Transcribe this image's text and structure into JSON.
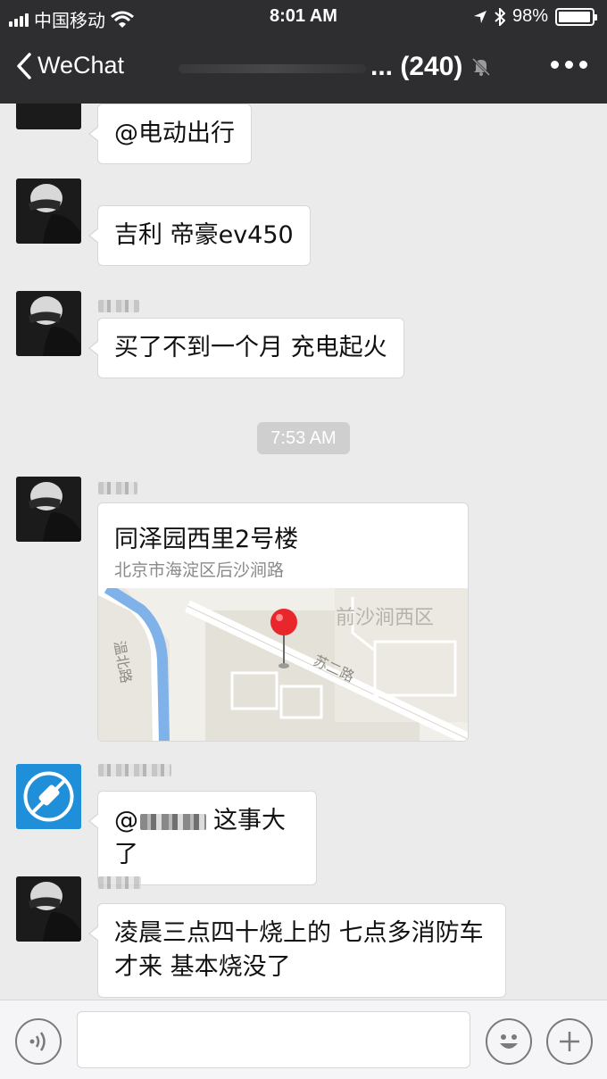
{
  "status_bar": {
    "carrier": "中国移动",
    "time": "8:01 AM",
    "battery": "98%",
    "battery_level": 0.98,
    "icons": [
      "signal-icon",
      "wifi-icon",
      "location-icon",
      "bluetooth-icon",
      "battery-icon"
    ]
  },
  "nav": {
    "back_label": "WeChat",
    "title": "... (240)",
    "icons": [
      "chevron-left-icon",
      "mute-icon",
      "more-icon"
    ]
  },
  "messages": [
    {
      "type": "text",
      "text": "@电动出行"
    },
    {
      "type": "text",
      "text": "吉利 帝豪ev450"
    },
    {
      "type": "text",
      "text": "买了不到一个月 充电起火"
    },
    {
      "type": "timestamp",
      "text": "7:53 AM"
    },
    {
      "type": "location",
      "title": "同泽园西里2号楼",
      "address": "北京市海淀区后沙涧路",
      "map_labels": {
        "district": "前沙涧西区",
        "road1": "苏二路",
        "road2": "温北路"
      }
    },
    {
      "type": "text",
      "text": "这事大了",
      "prefix": "@"
    },
    {
      "type": "text",
      "text": "凌晨三点四十烧上的 七点多消防车才来 基本烧没了"
    }
  ],
  "colors": {
    "header_bg": "#2e2e31",
    "chat_bg": "#ebebeb",
    "bubble_bg": "#ffffff",
    "pin_red": "#e8262b",
    "river_blue": "#7fb2e8"
  },
  "input_bar": {
    "icons": [
      "voice-icon",
      "emoji-icon",
      "plus-icon"
    ]
  }
}
